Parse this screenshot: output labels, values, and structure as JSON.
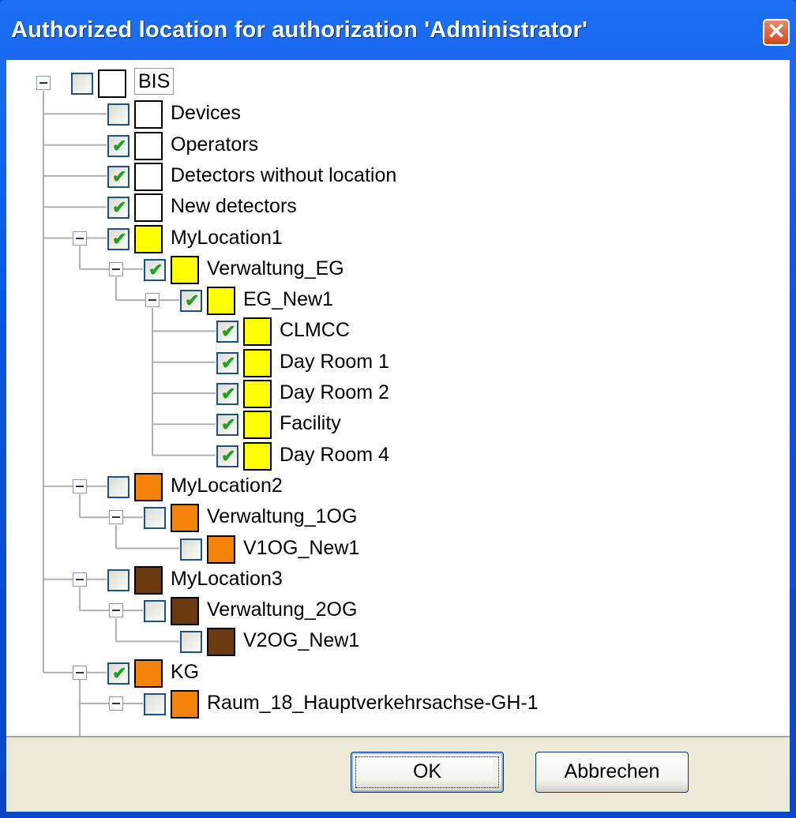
{
  "window": {
    "title": "Authorized location for authorization 'Administrator'",
    "close_glyph": "✕"
  },
  "tree": {
    "colors": {
      "white": "#ffffff",
      "yellow": "#ffff00",
      "orange": "#f5820a",
      "brown": "#6b3a10",
      "check": "#21a121"
    },
    "nodes": [
      {
        "label": "BIS",
        "depth": 0,
        "expanded": true,
        "checked": false,
        "color": "white",
        "boxed": true
      },
      {
        "label": "Devices",
        "depth": 1,
        "checked": false,
        "color": "white"
      },
      {
        "label": "Operators",
        "depth": 1,
        "checked": true,
        "color": "white"
      },
      {
        "label": "Detectors without location",
        "depth": 1,
        "checked": true,
        "color": "white"
      },
      {
        "label": "New detectors",
        "depth": 1,
        "checked": true,
        "color": "white"
      },
      {
        "label": "MyLocation1",
        "depth": 1,
        "expanded": true,
        "checked": true,
        "color": "yellow"
      },
      {
        "label": "Verwaltung_EG",
        "depth": 2,
        "expanded": true,
        "checked": true,
        "color": "yellow"
      },
      {
        "label": "EG_New1",
        "depth": 3,
        "expanded": true,
        "checked": true,
        "color": "yellow"
      },
      {
        "label": "CLMCC",
        "depth": 4,
        "checked": true,
        "color": "yellow"
      },
      {
        "label": "Day Room 1",
        "depth": 4,
        "checked": true,
        "color": "yellow"
      },
      {
        "label": "Day Room 2",
        "depth": 4,
        "checked": true,
        "color": "yellow"
      },
      {
        "label": "Facility",
        "depth": 4,
        "checked": true,
        "color": "yellow"
      },
      {
        "label": "Day Room 4",
        "depth": 4,
        "checked": true,
        "color": "yellow"
      },
      {
        "label": "MyLocation2",
        "depth": 1,
        "expanded": true,
        "checked": false,
        "color": "orange"
      },
      {
        "label": "Verwaltung_1OG",
        "depth": 2,
        "expanded": true,
        "checked": false,
        "color": "orange"
      },
      {
        "label": "V1OG_New1",
        "depth": 3,
        "checked": false,
        "color": "orange"
      },
      {
        "label": "MyLocation3",
        "depth": 1,
        "expanded": true,
        "checked": false,
        "color": "brown"
      },
      {
        "label": "Verwaltung_2OG",
        "depth": 2,
        "expanded": true,
        "checked": false,
        "color": "brown"
      },
      {
        "label": "V2OG_New1",
        "depth": 3,
        "checked": false,
        "color": "brown"
      },
      {
        "label": "KG",
        "depth": 1,
        "expanded": true,
        "checked": true,
        "color": "orange"
      },
      {
        "label": "Raum_18_Hauptverkehrsachse-GH-1",
        "depth": 2,
        "expanded": true,
        "checked": false,
        "color": "orange"
      }
    ]
  },
  "buttons": {
    "ok": "OK",
    "cancel": "Abbrechen"
  }
}
